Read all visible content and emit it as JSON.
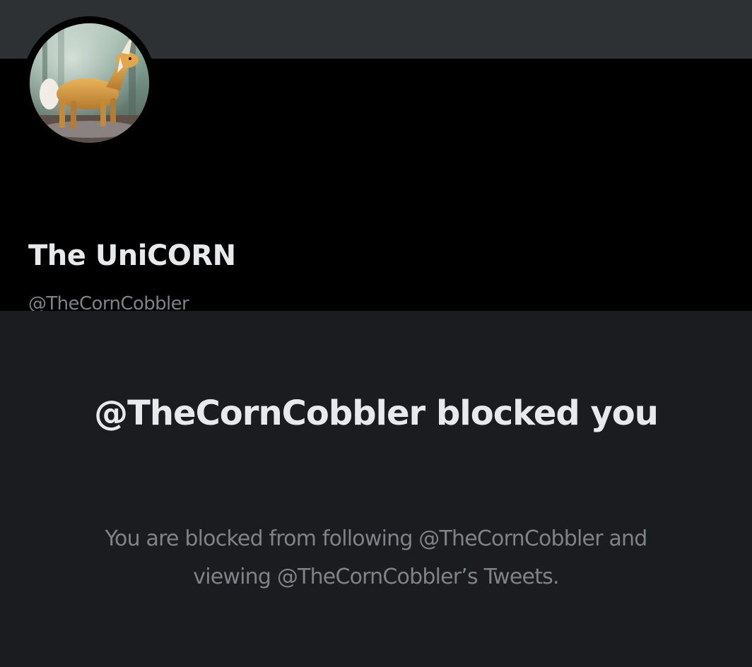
{
  "profile": {
    "display_name": "The UniCORN",
    "handle": "@TheCornCobbler",
    "avatar_icon": "unicorn-avatar"
  },
  "blocked": {
    "title": "@TheCornCobbler blocked you",
    "description": "You are blocked from following @TheCornCobbler and viewing @TheCornCobbler’s Tweets."
  },
  "colors": {
    "top_strip": "#2e3134",
    "header_background": "#000000",
    "panel_background": "#1b1c20",
    "primary_text": "#e7e9ea",
    "secondary_text": "#7e8388"
  }
}
